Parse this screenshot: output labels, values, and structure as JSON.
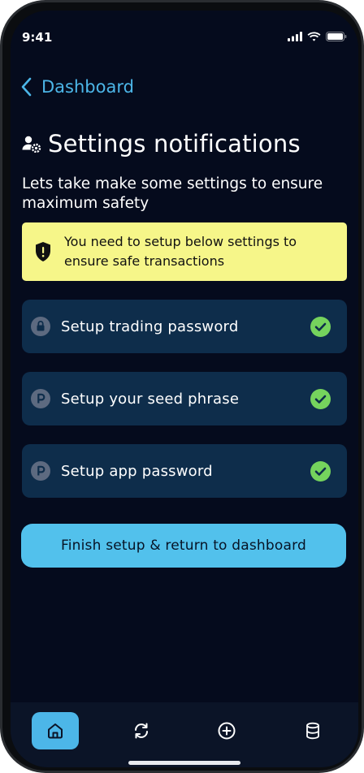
{
  "status_bar": {
    "time": "9:41"
  },
  "header": {
    "back_label": "Dashboard"
  },
  "page": {
    "title": "Settings notifications",
    "subtitle": "Lets take make some settings to ensure maximum safety"
  },
  "warning": {
    "text": "You need to setup below settings to ensure safe transactions"
  },
  "settings": [
    {
      "label": "Setup trading password",
      "icon": "lock-icon",
      "status": "done"
    },
    {
      "label": "Setup your seed phrase",
      "icon": "p-badge-icon",
      "status": "done"
    },
    {
      "label": "Setup app password",
      "icon": "p-badge-icon",
      "status": "done"
    }
  ],
  "finish_button": {
    "label": "Finish setup & return to dashboard"
  },
  "nav": {
    "items": [
      "home-icon",
      "swap-icon",
      "add-circle-icon",
      "database-icon"
    ],
    "active": "home-icon"
  },
  "colors": {
    "background": "#050b1d",
    "accent": "#4cb6e8",
    "card": "#0e2d4b",
    "warning": "#f6f689",
    "success": "#75d35d",
    "button": "#52c1ec"
  }
}
